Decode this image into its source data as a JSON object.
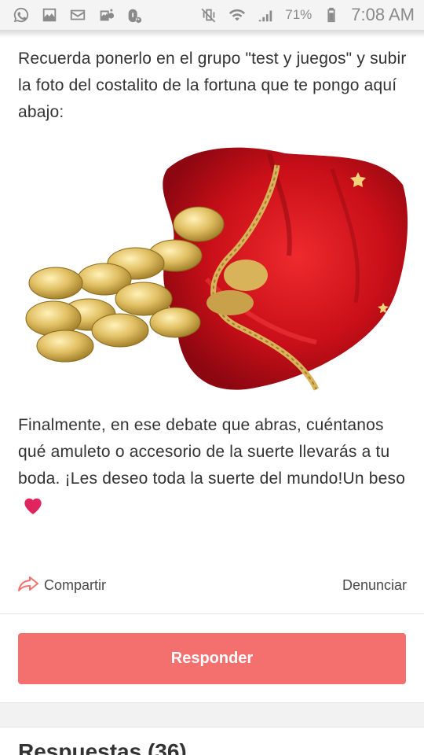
{
  "status_bar": {
    "battery_percent": "71%",
    "time": "7:08 AM",
    "left_icons": [
      "whatsapp-icon",
      "gallery-icon",
      "email-icon",
      "photo-bag-icon",
      "bug-icon"
    ],
    "right_icons": [
      "vibrate-mute-icon",
      "wifi-icon",
      "signal-icon",
      "battery-icon"
    ]
  },
  "post": {
    "paragraph_1": "Recuerda ponerlo en el grupo \"test y juegos\" y subir la foto del costalito de la fortuna que te pongo aquí abajo:",
    "paragraph_2": "Finalmente, en ese debate que abras, cuéntanos qué amuleto o accesorio de la suerte llevarás a tu boda. ¡Les deseo toda la suerte del mundo!Un beso",
    "image_alt": "costalito de la fortuna"
  },
  "actions": {
    "share_label": "Compartir",
    "report_label": "Denunciar",
    "reply_label": "Responder"
  },
  "replies": {
    "heading": "Respuestas (36)"
  },
  "colors": {
    "accent": "#f4706f",
    "heart": "#e0245e",
    "sack_red": "#d8141d",
    "gold": "#d8b04a"
  }
}
